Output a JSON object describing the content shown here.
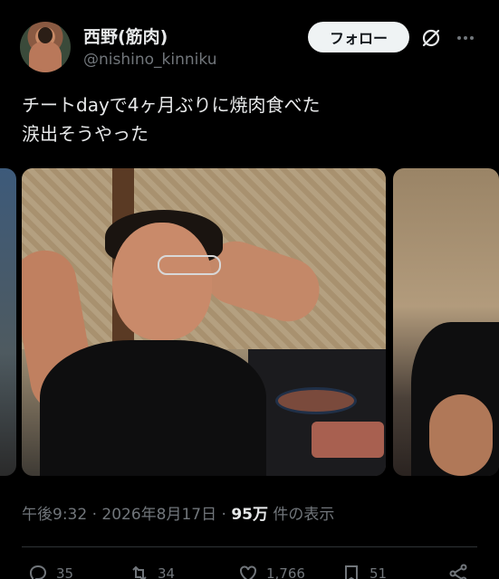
{
  "author": {
    "display_name": "西野(筋肉)",
    "handle": "@nishino_kinniku"
  },
  "header": {
    "follow_label": "フォロー",
    "grok_icon": "slash-circle-icon",
    "more_icon": "more-dots-icon"
  },
  "tweet": {
    "text": "チートdayで4ヶ月ぶりに焼肉食べた\n涙出そうやった"
  },
  "meta": {
    "time": "午後9:32",
    "sep1": "·",
    "date": "2026年8月17日",
    "sep2": "·",
    "views_count": "95万",
    "views_label": "件の表示"
  },
  "actions": {
    "reply_count": "35",
    "retweet_count": "34",
    "like_count": "1,766",
    "bookmark_count": "51"
  },
  "colors": {
    "background": "#000000",
    "text_primary": "#e7e9ea",
    "text_secondary": "#71767b",
    "follow_bg": "#eff3f4",
    "divider": "#2f3336"
  }
}
